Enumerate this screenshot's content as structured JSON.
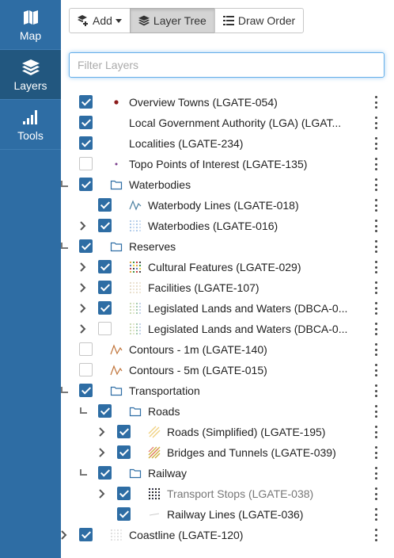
{
  "nav": {
    "map": "Map",
    "layers": "Layers",
    "tools": "Tools"
  },
  "toolbar": {
    "add": "Add",
    "layer_tree": "Layer Tree",
    "draw_order": "Draw Order"
  },
  "filter": {
    "placeholder": "Filter Layers",
    "value": ""
  },
  "tree": [
    {
      "label": "Overview Towns (LGATE-054)",
      "checked": true,
      "symbol": "dot-red",
      "expander": "none",
      "depth": 0
    },
    {
      "label": "Local Government Authority (LGA) (LGAT...",
      "checked": true,
      "symbol": "none",
      "expander": "none",
      "depth": 0
    },
    {
      "label": "Localities (LGATE-234)",
      "checked": true,
      "symbol": "none",
      "expander": "none",
      "depth": 0
    },
    {
      "label": "Topo Points of Interest (LGATE-135)",
      "checked": false,
      "symbol": "dot-purple",
      "expander": "none",
      "depth": 0
    },
    {
      "label": "Waterbodies",
      "checked": true,
      "symbol": "folder",
      "expander": "elbow",
      "depth": 0
    },
    {
      "label": "Waterbody Lines (LGATE-018)",
      "checked": true,
      "symbol": "wave-line",
      "expander": "none",
      "depth": 1
    },
    {
      "label": "Waterbodies (LGATE-016)",
      "checked": true,
      "symbol": "dot-grid-blue",
      "expander": "chevron",
      "depth": 1
    },
    {
      "label": "Reserves",
      "checked": true,
      "symbol": "folder",
      "expander": "elbow",
      "depth": 0
    },
    {
      "label": "Cultural Features (LGATE-029)",
      "checked": true,
      "symbol": "dot-grid-multi",
      "expander": "chevron",
      "depth": 1
    },
    {
      "label": "Facilities (LGATE-107)",
      "checked": true,
      "symbol": "dot-grid-beige",
      "expander": "chevron",
      "depth": 1
    },
    {
      "label": "Legislated Lands and Waters (DBCA-0...",
      "checked": true,
      "symbol": "dot-grid-green",
      "expander": "chevron",
      "depth": 1
    },
    {
      "label": "Legislated Lands and Waters (DBCA-0...",
      "checked": false,
      "symbol": "dot-grid-green",
      "expander": "chevron",
      "depth": 1
    },
    {
      "label": "Contours - 1m (LGATE-140)",
      "checked": false,
      "symbol": "wave-orange",
      "expander": "none",
      "depth": 0
    },
    {
      "label": "Contours - 5m (LGATE-015)",
      "checked": false,
      "symbol": "wave-orange",
      "expander": "none",
      "depth": 0
    },
    {
      "label": "Transportation",
      "checked": true,
      "symbol": "folder",
      "expander": "elbow",
      "depth": 0
    },
    {
      "label": "Roads",
      "checked": true,
      "symbol": "folder",
      "expander": "elbow",
      "depth": 1
    },
    {
      "label": "Roads (Simplified) (LGATE-195)",
      "checked": true,
      "symbol": "hatch-light",
      "expander": "chevron",
      "depth": 2
    },
    {
      "label": "Bridges and Tunnels (LGATE-039)",
      "checked": true,
      "symbol": "hatch-strong",
      "expander": "chevron",
      "depth": 2
    },
    {
      "label": "Railway",
      "checked": true,
      "symbol": "folder",
      "expander": "elbow",
      "depth": 1
    },
    {
      "label": "Transport Stops (LGATE-038)",
      "checked": true,
      "symbol": "dot-grid-black",
      "expander": "chevron",
      "depth": 2,
      "dim": true
    },
    {
      "label": "Railway Lines (LGATE-036)",
      "checked": true,
      "symbol": "line-grey",
      "expander": "none",
      "depth": 2
    },
    {
      "label": "Coastline (LGATE-120)",
      "checked": true,
      "symbol": "dot-grid-faint",
      "expander": "chevron",
      "depth": 0
    }
  ]
}
